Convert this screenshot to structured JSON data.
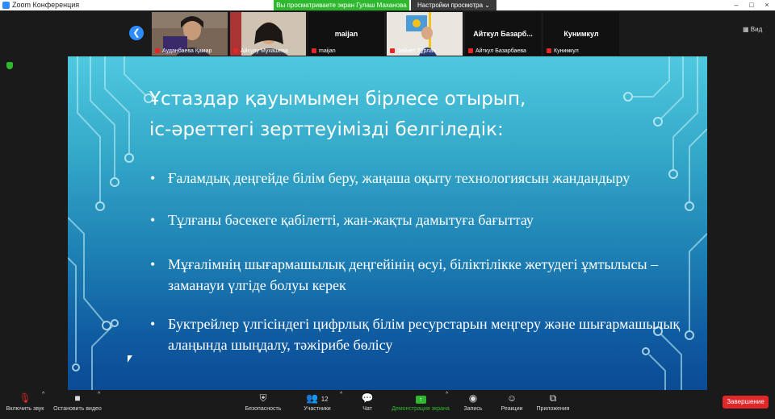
{
  "window": {
    "title": "Zoom Конференция",
    "controls": [
      "–",
      "□",
      "×"
    ]
  },
  "banner": {
    "sharing_text": "Вы просматриваете экран Гулаш Маханова",
    "view_options_label": "Настройки просмотра"
  },
  "gallery": {
    "view_label": "Вид",
    "participants": [
      {
        "name": "Ауданбаева Қамар",
        "center": ""
      },
      {
        "name": "Айсулу Мухашева",
        "center": ""
      },
      {
        "name": "maijan",
        "center": "maijan"
      },
      {
        "name": "Зейнет Тұрлан",
        "center": ""
      },
      {
        "name": "Айткул Базарбаева",
        "center": "Айткул  Базарб..."
      },
      {
        "name": "Кунимкул",
        "center": "Кунимкул"
      }
    ]
  },
  "slide": {
    "title_line1": "Ұстаздар қауымымен бірлесе отырып,",
    "title_line2": "іс-әреттегі зерттеуімізді белгіледік:",
    "bullet_symbol": "•",
    "bullets": [
      "Ғаламдық деңгейде білім беру, жаңаша оқыту технологиясын жандандыру",
      "Тұлғаны бәсекеге қабілетті, жан-жақты дамытуға бағыттау",
      "Мұғалімнің шығармашылық деңгейінің өсуі, біліктілікке жетудегі ұмтылысы – заманауи үлгіде болуы керек",
      "Буктрейлер үлгісіндегі цифрлық білім ресурстарын меңгеру және шығармашылық алаңында шыңдалу, тәжірибе бөлісу"
    ]
  },
  "toolbar": {
    "mute_label": "Включить звук",
    "video_label": "Остановить видео",
    "security_label": "Безопасность",
    "participants_label": "Участники",
    "participants_count": "12",
    "chat_label": "Чат",
    "share_label": "Демонстрация экрана",
    "record_label": "Запись",
    "reactions_label": "Реакции",
    "apps_label": "Приложения",
    "end_label": "Завершение"
  },
  "colors": {
    "share_banner": "#2eb82e",
    "accent": "#2d8cff",
    "end_button": "#e02828"
  }
}
